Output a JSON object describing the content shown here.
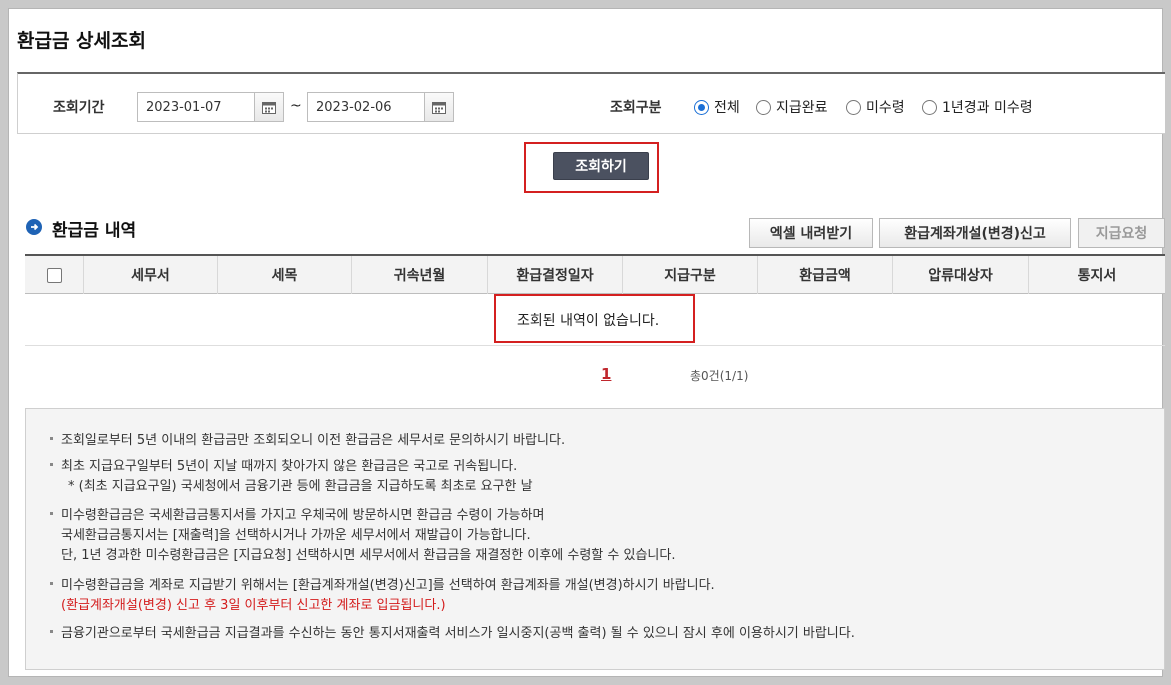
{
  "page": {
    "title": "환급금 상세조회"
  },
  "search": {
    "period_label": "조회기간",
    "start_date": "2023-01-07",
    "end_date": "2023-02-06",
    "tilde": "~",
    "type_label": "조회구분",
    "options": [
      {
        "label": "전체",
        "selected": true
      },
      {
        "label": "지급완료",
        "selected": false
      },
      {
        "label": "미수령",
        "selected": false
      },
      {
        "label": "1년경과 미수령",
        "selected": false
      }
    ],
    "query_button": "조회하기"
  },
  "section": {
    "title": "환급금 내역",
    "buttons": {
      "excel": "엑셀 내려받기",
      "account": "환급계좌개설(변경)신고",
      "request": "지급요청"
    }
  },
  "table": {
    "columns": [
      "세무서",
      "세목",
      "귀속년월",
      "환급결정일자",
      "지급구분",
      "환급금액",
      "압류대상자",
      "통지서"
    ],
    "empty_message": "조회된 내역이 없습니다."
  },
  "pagination": {
    "current_page": "1",
    "total": "총0건(1/1)"
  },
  "notices": [
    {
      "text": "조회일로부터 5년 이내의 환급금만 조회되오니 이전 환급금은 세무서로 문의하시기 바랍니다."
    },
    {
      "text": "최초 지급요구일부터 5년이 지날 때까지 찾아가지 않은 환급금은 국고로 귀속됩니다.",
      "sub": "* (최초 지급요구일) 국세청에서 금융기관 등에 환급금을 지급하도록 최초로 요구한 날"
    },
    {
      "text": "미수령환급금은 국세환급금통지서를 가지고 우체국에 방문하시면 환급금 수령이 가능하며",
      "sub": "국세환급금통지서는 [재출력]을 선택하시거나 가까운 세무서에서 재발급이 가능합니다.",
      "sub2": "단, 1년 경과한 미수령환급금은 [지급요청] 선택하시면 세무서에서 환급금을 재결정한 이후에 수령할 수 있습니다."
    },
    {
      "text": "미수령환급금을 계좌로 지급받기 위해서는 [환급계좌개설(변경)신고]를 선택하여 환급계좌를 개설(변경)하시기 바랍니다.",
      "red": "(환급계좌개설(변경) 신고 후 3일 이후부터 신고한 계좌로 입금됩니다.)"
    },
    {
      "text": "금융기관으로부터 국세환급금 지급결과를 수신하는 동안 통지서재출력 서비스가 일시중지(공백 출력) 될 수 있으니 잠시 후에 이용하시기 바랍니다."
    }
  ],
  "colors": {
    "accent": "#1a6fd6",
    "highlight_box": "#d42020",
    "button_dark": "#4b5160",
    "page_link": "#c0272d"
  }
}
